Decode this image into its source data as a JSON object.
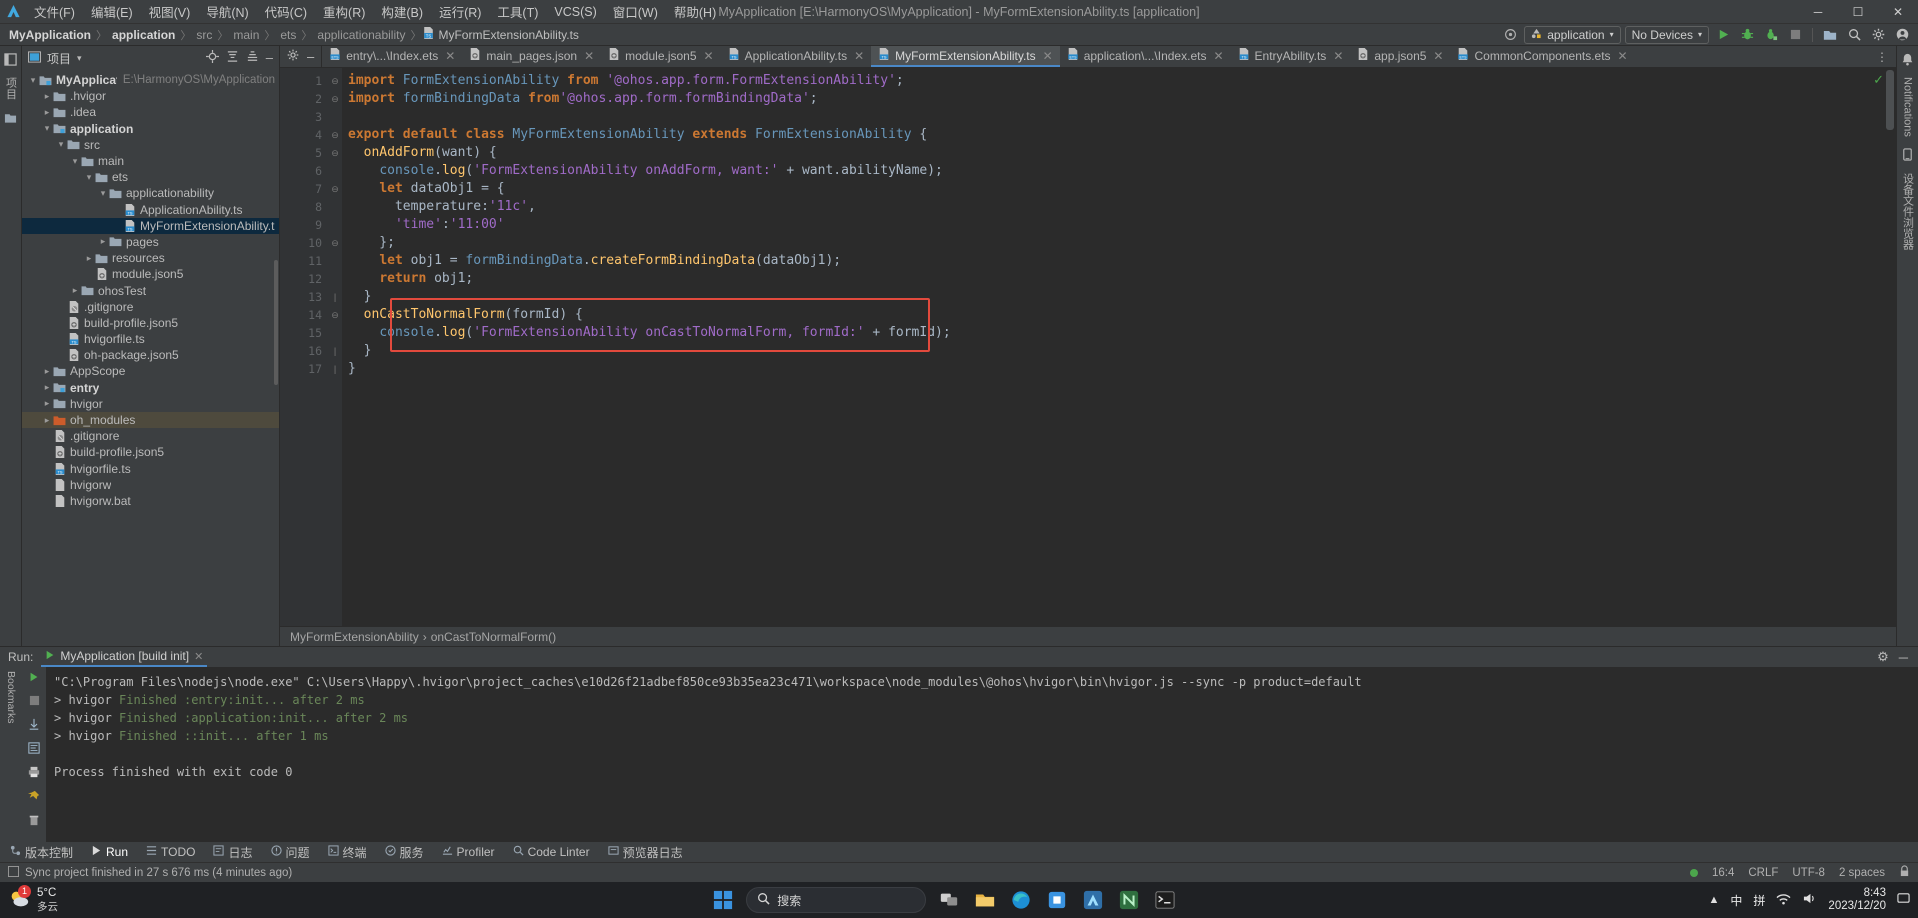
{
  "window": {
    "title": "MyApplication [E:\\HarmonyOS\\MyApplication] - MyFormExtensionAbility.ts [application]",
    "minimize": "─",
    "maximize": "☐",
    "close": "✕"
  },
  "menu": {
    "items": [
      {
        "label": "文件(F)"
      },
      {
        "label": "编辑(E)"
      },
      {
        "label": "视图(V)"
      },
      {
        "label": "导航(N)"
      },
      {
        "label": "代码(C)"
      },
      {
        "label": "重构(R)"
      },
      {
        "label": "构建(B)"
      },
      {
        "label": "运行(R)"
      },
      {
        "label": "工具(T)"
      },
      {
        "label": "VCS(S)"
      },
      {
        "label": "窗口(W)"
      },
      {
        "label": "帮助(H)"
      }
    ]
  },
  "breadcrumb": {
    "items": [
      "MyApplication",
      "application",
      "src",
      "main",
      "ets",
      "applicationability"
    ],
    "file": "MyFormExtensionAbility.ts",
    "separator": "〉"
  },
  "run_toolbar": {
    "config_label": "application",
    "device_label": "No Devices",
    "caret": "▾",
    "icons": [
      "target-icon",
      "run-icon",
      "debug-icon",
      "profile-icon",
      "stop-icon",
      "device-manager-icon",
      "search-everywhere-icon",
      "settings-icon",
      "account-icon"
    ]
  },
  "project_panel": {
    "title": "项目",
    "caret": "▾",
    "actions": [
      "locate-icon",
      "expand-all-icon",
      "collapse-all-icon",
      "hide-icon"
    ],
    "tree": [
      {
        "depth": 0,
        "arrow": "⌄",
        "icon": "module-folder",
        "label": "MyApplication",
        "bold": true,
        "path": "E:\\HarmonyOS\\MyApplication",
        "state": "normal"
      },
      {
        "depth": 1,
        "arrow": "›",
        "icon": "folder",
        "label": ".hvigor",
        "bold": false,
        "path": "",
        "state": "normal"
      },
      {
        "depth": 1,
        "arrow": "›",
        "icon": "folder",
        "label": ".idea",
        "bold": false,
        "path": "",
        "state": "normal"
      },
      {
        "depth": 1,
        "arrow": "⌄",
        "icon": "module-folder",
        "label": "application",
        "bold": true,
        "path": "",
        "state": "normal"
      },
      {
        "depth": 2,
        "arrow": "⌄",
        "icon": "folder",
        "label": "src",
        "bold": false,
        "path": "",
        "state": "normal"
      },
      {
        "depth": 3,
        "arrow": "⌄",
        "icon": "folder",
        "label": "main",
        "bold": false,
        "path": "",
        "state": "normal"
      },
      {
        "depth": 4,
        "arrow": "⌄",
        "icon": "folder",
        "label": "ets",
        "bold": false,
        "path": "",
        "state": "normal"
      },
      {
        "depth": 5,
        "arrow": "⌄",
        "icon": "folder",
        "label": "applicationability",
        "bold": false,
        "path": "",
        "state": "normal"
      },
      {
        "depth": 6,
        "arrow": "",
        "icon": "ts-file",
        "label": "ApplicationAbility.ts",
        "bold": false,
        "path": "",
        "state": "normal"
      },
      {
        "depth": 6,
        "arrow": "",
        "icon": "ts-file",
        "label": "MyFormExtensionAbility.ts",
        "bold": false,
        "path": "",
        "state": "selected"
      },
      {
        "depth": 5,
        "arrow": "›",
        "icon": "folder",
        "label": "pages",
        "bold": false,
        "path": "",
        "state": "normal"
      },
      {
        "depth": 4,
        "arrow": "›",
        "icon": "folder",
        "label": "resources",
        "bold": false,
        "path": "",
        "state": "normal"
      },
      {
        "depth": 4,
        "arrow": "",
        "icon": "json-file",
        "label": "module.json5",
        "bold": false,
        "path": "",
        "state": "normal"
      },
      {
        "depth": 3,
        "arrow": "›",
        "icon": "folder",
        "label": "ohosTest",
        "bold": false,
        "path": "",
        "state": "normal"
      },
      {
        "depth": 2,
        "arrow": "",
        "icon": "gitignore-file",
        "label": ".gitignore",
        "bold": false,
        "path": "",
        "state": "normal"
      },
      {
        "depth": 2,
        "arrow": "",
        "icon": "json-file",
        "label": "build-profile.json5",
        "bold": false,
        "path": "",
        "state": "normal"
      },
      {
        "depth": 2,
        "arrow": "",
        "icon": "ts-file",
        "label": "hvigorfile.ts",
        "bold": false,
        "path": "",
        "state": "normal"
      },
      {
        "depth": 2,
        "arrow": "",
        "icon": "json-file",
        "label": "oh-package.json5",
        "bold": false,
        "path": "",
        "state": "normal"
      },
      {
        "depth": 1,
        "arrow": "›",
        "icon": "folder",
        "label": "AppScope",
        "bold": false,
        "path": "",
        "state": "normal"
      },
      {
        "depth": 1,
        "arrow": "›",
        "icon": "module-folder",
        "label": "entry",
        "bold": true,
        "path": "",
        "state": "normal"
      },
      {
        "depth": 1,
        "arrow": "›",
        "icon": "folder",
        "label": "hvigor",
        "bold": false,
        "path": "",
        "state": "normal"
      },
      {
        "depth": 1,
        "arrow": "›",
        "icon": "excluded-folder",
        "label": "oh_modules",
        "bold": false,
        "path": "",
        "state": "highlight"
      },
      {
        "depth": 1,
        "arrow": "",
        "icon": "gitignore-file",
        "label": ".gitignore",
        "bold": false,
        "path": "",
        "state": "normal"
      },
      {
        "depth": 1,
        "arrow": "",
        "icon": "json-file",
        "label": "build-profile.json5",
        "bold": false,
        "path": "",
        "state": "normal"
      },
      {
        "depth": 1,
        "arrow": "",
        "icon": "ts-file",
        "label": "hvigorfile.ts",
        "bold": false,
        "path": "",
        "state": "normal"
      },
      {
        "depth": 1,
        "arrow": "",
        "icon": "file",
        "label": "hvigorw",
        "bold": false,
        "path": "",
        "state": "normal"
      },
      {
        "depth": 1,
        "arrow": "",
        "icon": "file",
        "label": "hvigorw.bat",
        "bold": false,
        "path": "",
        "state": "normal"
      }
    ]
  },
  "left_rail": {
    "items": [
      "项目",
      "结构"
    ]
  },
  "right_rail": {
    "items": [
      "Notifications",
      "设备文件浏览器"
    ]
  },
  "editor_tabs": {
    "items": [
      {
        "label": "entry\\...\\Index.ets",
        "icon": "ets-file",
        "active": false
      },
      {
        "label": "main_pages.json",
        "icon": "json-file",
        "active": false
      },
      {
        "label": "module.json5",
        "icon": "json-file",
        "active": false
      },
      {
        "label": "ApplicationAbility.ts",
        "icon": "ts-file",
        "active": false
      },
      {
        "label": "MyFormExtensionAbility.ts",
        "icon": "ts-file",
        "active": true
      },
      {
        "label": "application\\...\\Index.ets",
        "icon": "ets-file",
        "active": false
      },
      {
        "label": "EntryAbility.ts",
        "icon": "ts-file",
        "active": false
      },
      {
        "label": "app.json5",
        "icon": "json-file",
        "active": false
      },
      {
        "label": "CommonComponents.ets",
        "icon": "ets-file",
        "active": false
      }
    ],
    "close_glyph": "✕",
    "more_glyph": "⋮"
  },
  "editor": {
    "line_numbers": [
      "1",
      "2",
      "3",
      "4",
      "5",
      "6",
      "7",
      "8",
      "9",
      "10",
      "11",
      "12",
      "13",
      "14",
      "15",
      "16",
      "17"
    ],
    "lines": [
      "import FormExtensionAbility from '@ohos.app.form.FormExtensionAbility';",
      "import formBindingData from'@ohos.app.form.formBindingData';",
      "",
      "export default class MyFormExtensionAbility extends FormExtensionAbility {",
      "  onAddForm(want) {",
      "    console.log('FormExtensionAbility onAddForm, want:' + want.abilityName);",
      "    let dataObj1 = {",
      "      temperature:'11c',",
      "      'time':'11:00'",
      "    };",
      "    let obj1 = formBindingData.createFormBindingData(dataObj1);",
      "    return obj1;",
      "  }",
      "  onCastToNormalForm(formId) {",
      "    console.log('FormExtensionAbility onCastToNormalForm, formId:' + formId);",
      "  }",
      "}"
    ],
    "highlight_note": "red-rectangle-around-onCastToNormalForm",
    "status_icon": "inspection-ok-icon"
  },
  "editor_breadcrumb": {
    "class_name": "MyFormExtensionAbility",
    "method_name": "onCastToNormalForm()",
    "separator": "›"
  },
  "run_panel": {
    "label": "Run:",
    "tab_label": "MyApplication [build init]",
    "close_glyph": "✕",
    "settings_glyph": "⚙",
    "minimize_glyph": "─",
    "console_lines": [
      {
        "text": "\"C:\\Program Files\\nodejs\\node.exe\" C:\\Users\\Happy\\.hvigor\\project_caches\\e10d26f21adbef850ce93b35ea23c471\\workspace\\node_modules\\@ohos\\hvigor\\bin\\hvigor.js --sync -p product=default",
        "style": "gray"
      },
      {
        "text": "> hvigor Finished :entry:init... after 2 ms",
        "style": "mixed"
      },
      {
        "text": "> hvigor Finished :application:init... after 2 ms",
        "style": "mixed"
      },
      {
        "text": "> hvigor Finished ::init... after 1 ms",
        "style": "mixed"
      },
      {
        "text": "",
        "style": "gray"
      },
      {
        "text": "Process finished with exit code 0",
        "style": "gray"
      }
    ],
    "side_icons": [
      "rerun-icon",
      "stop-icon",
      "scroll-down-icon",
      "soft-wrap-icon",
      "print-icon",
      "clear-icon",
      "pin-icon",
      "trash-icon"
    ]
  },
  "bottom_tabs": {
    "items": [
      {
        "label": "版本控制",
        "icon": "vcs-icon",
        "active": false
      },
      {
        "label": "Run",
        "icon": "run-icon",
        "active": true
      },
      {
        "label": "TODO",
        "icon": "todo-icon",
        "active": false
      },
      {
        "label": "日志",
        "icon": "log-icon",
        "active": false
      },
      {
        "label": "问题",
        "icon": "problems-icon",
        "active": false
      },
      {
        "label": "终端",
        "icon": "terminal-icon",
        "active": false
      },
      {
        "label": "服务",
        "icon": "services-icon",
        "active": false
      },
      {
        "label": "Profiler",
        "icon": "profiler-icon",
        "active": false
      },
      {
        "label": "Code Linter",
        "icon": "linter-icon",
        "active": false
      },
      {
        "label": "预览器日志",
        "icon": "previewer-icon",
        "active": false
      }
    ]
  },
  "statusbar": {
    "message": "Sync project finished in 27 s 676 ms (4 minutes ago)",
    "caret_position": "16:4",
    "line_separator": "CRLF",
    "encoding": "UTF-8",
    "indent": "2 spaces",
    "lock_icon": "lock-icon"
  },
  "taskbar": {
    "weather_temp": "5°C",
    "weather_desc": "多云",
    "badge_count": "1",
    "search_placeholder": "搜索",
    "clock_time": "8:43",
    "clock_date": "2023/12/20",
    "ime_lang": "中",
    "ime_mode": "拼",
    "apps": [
      "start-icon",
      "search-pill",
      "task-view-icon",
      "file-explorer-icon",
      "edge-icon",
      "store-icon",
      "deveco-icon",
      "node-icon",
      "terminal-icon"
    ],
    "tray": [
      "chevron-up-icon",
      "ime-icon",
      "network-icon",
      "volume-icon",
      "notification-icon"
    ]
  },
  "colors": {
    "accent": "#4a88c7",
    "highlight_box": "#e24a3d",
    "selection": "#0d293e",
    "panel_bg": "#3c3f41",
    "editor_bg": "#2b2b2b"
  }
}
